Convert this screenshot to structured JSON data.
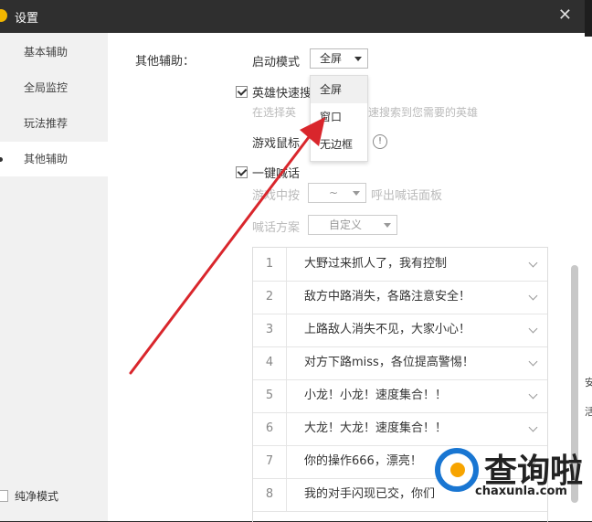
{
  "window": {
    "title": "设置"
  },
  "sidebar": {
    "items": [
      {
        "label": "基本辅助"
      },
      {
        "label": "全局监控"
      },
      {
        "label": "玩法推荐"
      },
      {
        "label": "其他辅助",
        "active": true
      }
    ],
    "pure_mode": "纯净模式"
  },
  "section_label": "其他辅助：",
  "launch_mode": {
    "label": "启动模式",
    "value": "全屏",
    "options": [
      "全屏",
      "窗口",
      "无边框"
    ]
  },
  "hero_search": {
    "label": "英雄快速搜",
    "hint": "在选择英",
    "hint2": "速搜索到您需要的英雄"
  },
  "mouse": {
    "label": "游戏鼠标"
  },
  "one_key": {
    "label": "一键喊话"
  },
  "middle_key": {
    "label": "游戏中按",
    "value": "~",
    "suffix": "呼出喊话面板"
  },
  "scheme": {
    "label": "喊话方案",
    "value": "自定义"
  },
  "phrases": [
    {
      "num": "1",
      "text": "大野过来抓人了，我有控制"
    },
    {
      "num": "2",
      "text": "敌方中路消失，各路注意安全！"
    },
    {
      "num": "3",
      "text": "上路敌人消失不见，大家小心！"
    },
    {
      "num": "4",
      "text": "对方下路miss，各位提高警惕！"
    },
    {
      "num": "5",
      "text": "小龙！小龙！速度集合！！"
    },
    {
      "num": "6",
      "text": "大龙！大龙！速度集合！！"
    },
    {
      "num": "7",
      "text": "你的操作666，漂亮！"
    },
    {
      "num": "8",
      "text": "我的对手闪现已交，你们"
    }
  ],
  "watermark": {
    "brand": "查询啦",
    "url": "chaxunla.com"
  },
  "edge_chars": [
    "安",
    "活"
  ],
  "colors": {
    "titlebar": "#2f2f2f",
    "arrow": "#d9262c",
    "brand_blue": "#1976d2"
  }
}
